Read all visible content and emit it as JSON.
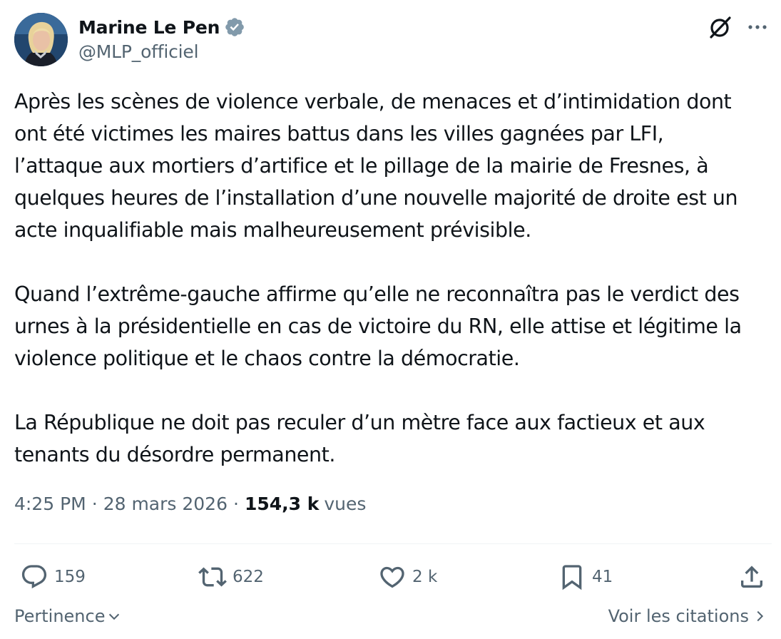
{
  "author": {
    "name": "Marine Le Pen",
    "handle": "@MLP_officiel",
    "verified": true
  },
  "icons": {
    "verified": "verified-badge-icon",
    "grok": "grok-icon",
    "more": "more-icon",
    "reply": "reply-icon",
    "retweet": "retweet-icon",
    "like": "heart-icon",
    "bookmark": "bookmark-icon",
    "share": "share-icon"
  },
  "tweet": {
    "paragraphs": [
      "Après les scènes de violence verbale, de menaces et d’intimidation dont\nont été victimes les maires battus dans les villes gagnées par LFI,\nl’attaque aux mortiers d’artifice et le pillage de la mairie de Fresnes, à\nquelques heures de l’installation d’une nouvelle majorité de droite est un\nacte inqualifiable mais malheureusement prévisible.",
      "Quand l’extrême-gauche affirme qu’elle ne reconnaîtra pas le verdict des\nurnes à la présidentielle en cas de victoire du RN, elle attise et légitime la\nviolence politique et le chaos contre la démocratie.",
      "La République ne doit pas reculer d’un mètre face aux factieux et aux\ntenants du désordre permanent."
    ],
    "time": "4:25 PM",
    "date": "28 mars 2026",
    "separator": "·",
    "views_count": "154,3 k",
    "views_label": "vues"
  },
  "actions": {
    "replies": "159",
    "retweets": "622",
    "likes": "2 k",
    "bookmarks": "41"
  },
  "footer": {
    "sort_label": "Pertinence",
    "quotes_label": "Voir les citations"
  },
  "colors": {
    "text": "#0f1419",
    "secondary": "#536471",
    "verified": "#829aab",
    "divider": "#eff3f4"
  }
}
